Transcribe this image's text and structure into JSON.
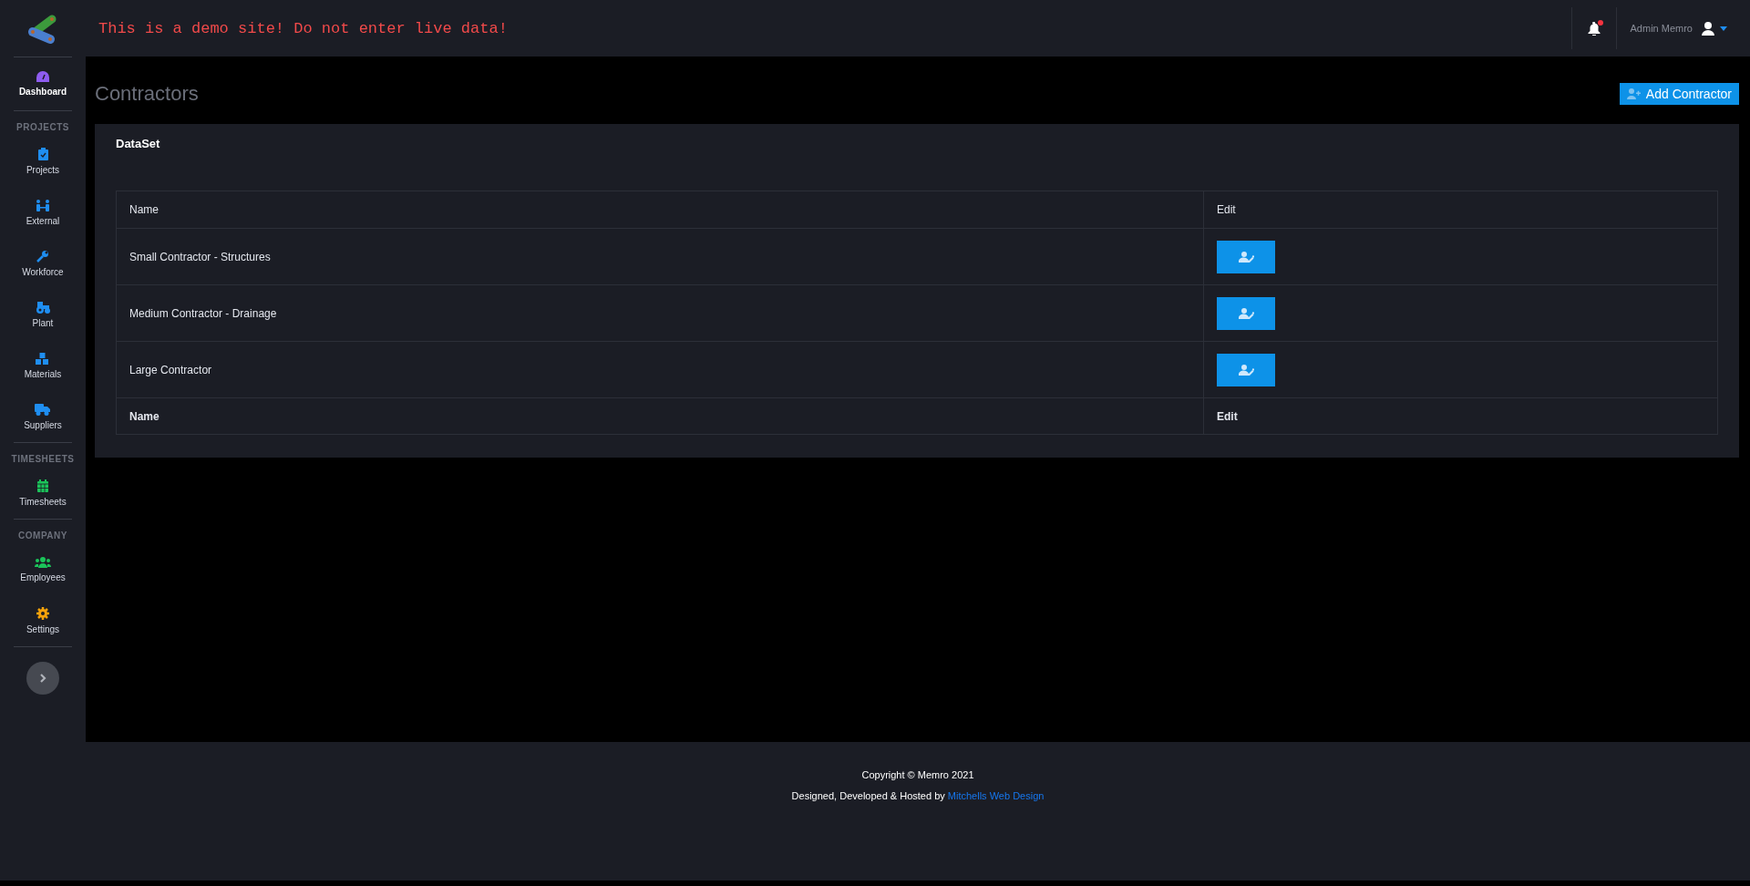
{
  "banner": "This is a demo site! Do not enter live data!",
  "user": {
    "name": "Admin Memro",
    "has_notification": true
  },
  "sidebar": {
    "groups": [
      {
        "items": [
          {
            "label": "Dashboard",
            "color": "#8e5cf0",
            "selected": true
          }
        ]
      },
      {
        "heading": "PROJECTS",
        "items": [
          {
            "label": "Projects",
            "color": "#1f8ef1",
            "selected": false
          },
          {
            "label": "External",
            "color": "#1f8ef1",
            "selected": false
          },
          {
            "label": "Workforce",
            "color": "#1f8ef1",
            "selected": false
          },
          {
            "label": "Plant",
            "color": "#1f8ef1",
            "selected": false
          },
          {
            "label": "Materials",
            "color": "#1f8ef1",
            "selected": false
          },
          {
            "label": "Suppliers",
            "color": "#1f8ef1",
            "selected": false
          }
        ]
      },
      {
        "heading": "TIMESHEETS",
        "items": [
          {
            "label": "Timesheets",
            "color": "#1bc45a",
            "selected": false
          }
        ]
      },
      {
        "heading": "COMPANY",
        "items": [
          {
            "label": "Employees",
            "color": "#1bc45a",
            "selected": false
          },
          {
            "label": "Settings",
            "color": "#f5a20b",
            "selected": false
          }
        ]
      }
    ]
  },
  "page": {
    "title": "Contractors",
    "add_button": "Add Contractor"
  },
  "card": {
    "title": "DataSet",
    "table": {
      "columns": [
        "Name",
        "Edit"
      ],
      "rows": [
        {
          "name": "Small Contractor - Structures"
        },
        {
          "name": "Medium Contractor - Drainage"
        },
        {
          "name": "Large Contractor"
        }
      ],
      "footer": [
        "Name",
        "Edit"
      ]
    }
  },
  "footer": {
    "copyright": "Copyright © Memro 2021",
    "credit": "Designed, Developed & Hosted by ",
    "credit_link": "Mitchells Web Design"
  }
}
